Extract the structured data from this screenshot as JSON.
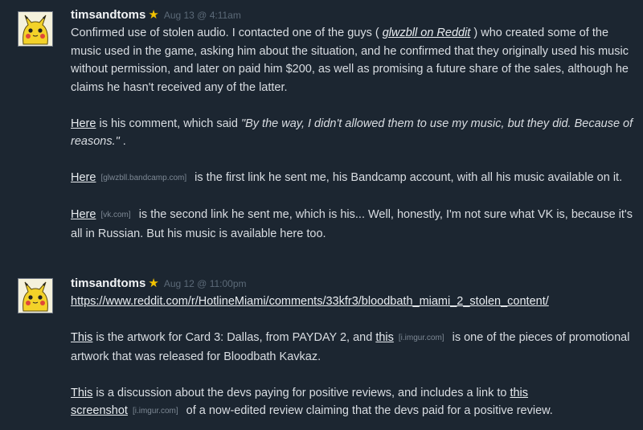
{
  "posts": [
    {
      "author": "timsandtoms",
      "star": "★",
      "date": "Aug 13 @ 4:11am",
      "p1": {
        "a": "Confirmed use of stolen audio. I contacted one of the guys ( ",
        "link": "glwzbll on Reddit",
        "b": " ) who created some of the music used in the game, asking him about the situation, and he confirmed that they originally used his music without permission, and later on paid him $200, as well as promising a future share of the sales, although he claims he hasn't received any of the latter."
      },
      "p2": {
        "link": "Here",
        "a": " is his comment, which said ",
        "quote": "\"By the way, I didn't allowed them to use my music, but they did. Because of reasons.\"",
        "b": " ."
      },
      "p3": {
        "link": "Here",
        "domain": "[glwzbll.bandcamp.com]",
        "a": " is the first link he sent me, his Bandcamp account, with all his music available on it."
      },
      "p4": {
        "link": "Here",
        "domain": "[vk.com]",
        "a": " is the second link he sent me, which is his... Well, honestly, I'm not sure what VK is, because it's all in Russian. But his music is available here too."
      }
    },
    {
      "author": "timsandtoms",
      "star": "★",
      "date": "Aug 12 @ 11:00pm",
      "url": "https://www.reddit.com/r/HotlineMiami/comments/33kfr3/bloodbath_miami_2_stolen_content/",
      "p2": {
        "link1": "This",
        "a": " is the artwork for Card 3: Dallas, from PAYDAY 2, and ",
        "link2": "this",
        "domain": "[i.imgur.com]",
        "b": " is one of the pieces of promotional artwork that was released for Bloodbath Kavkaz."
      },
      "p3": {
        "link1": "This",
        "a": " is a discussion about the devs paying for positive reviews, and includes a link to ",
        "link2": "this screenshot",
        "domain": "[i.imgur.com]",
        "b": " of a now-edited review claiming that the devs paid for a positive review."
      }
    }
  ]
}
